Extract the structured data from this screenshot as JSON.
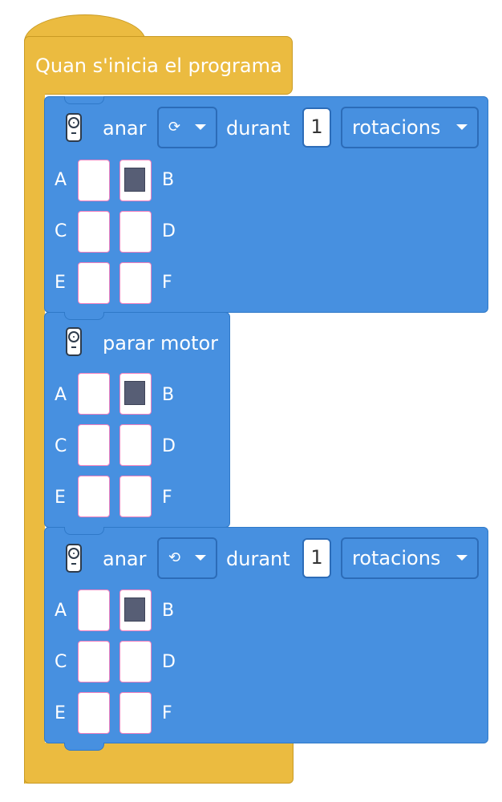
{
  "hat": {
    "label": "Quan s'inicia el programa"
  },
  "blocks": [
    {
      "verb": "anar",
      "direction_icon": "rotate-clockwise-icon",
      "direction_glyph": "⟳",
      "during": "durant",
      "amount": "1",
      "unit": "rotacions",
      "ports": [
        {
          "label": "A",
          "selected": false
        },
        {
          "label": "B",
          "selected": true
        },
        {
          "label": "C",
          "selected": false
        },
        {
          "label": "D",
          "selected": false
        },
        {
          "label": "E",
          "selected": false
        },
        {
          "label": "F",
          "selected": false
        }
      ]
    },
    {
      "verb": "parar motor",
      "ports": [
        {
          "label": "A",
          "selected": false
        },
        {
          "label": "B",
          "selected": true
        },
        {
          "label": "C",
          "selected": false
        },
        {
          "label": "D",
          "selected": false
        },
        {
          "label": "E",
          "selected": false
        },
        {
          "label": "F",
          "selected": false
        }
      ]
    },
    {
      "verb": "anar",
      "direction_icon": "rotate-counterclockwise-icon",
      "direction_glyph": "⟲",
      "during": "durant",
      "amount": "1",
      "unit": "rotacions",
      "ports": [
        {
          "label": "A",
          "selected": false
        },
        {
          "label": "B",
          "selected": true
        },
        {
          "label": "C",
          "selected": false
        },
        {
          "label": "D",
          "selected": false
        },
        {
          "label": "E",
          "selected": false
        },
        {
          "label": "F",
          "selected": false
        }
      ]
    }
  ],
  "colors": {
    "hat": "#ebbb40",
    "motion_block": "#4790e0",
    "port_selected": "#575e75",
    "port_border": "#f27fbe"
  }
}
